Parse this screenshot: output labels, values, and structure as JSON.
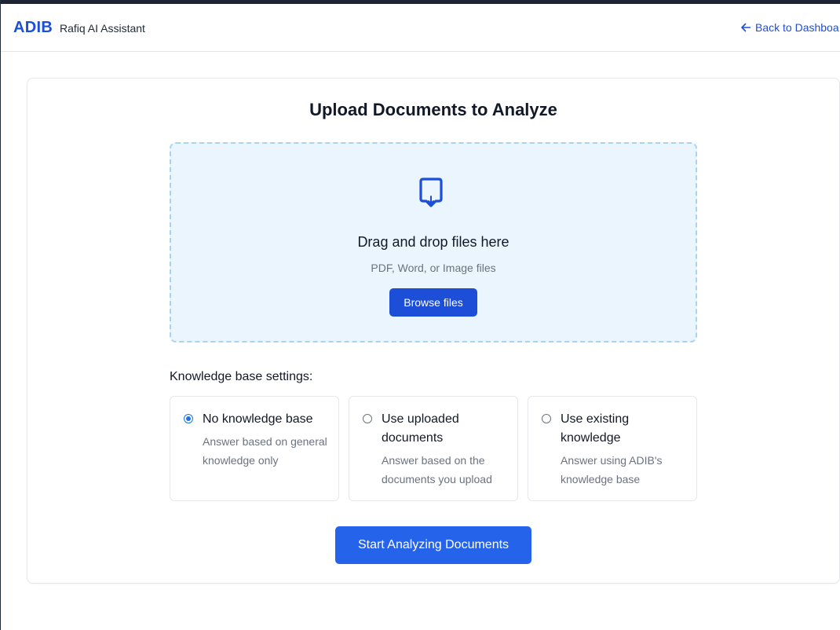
{
  "header": {
    "logo": "ADIB",
    "app_name": "Rafiq AI Assistant",
    "back_link": "Back to Dashboa"
  },
  "upload": {
    "title": "Upload Documents to Analyze",
    "drop_title": "Drag and drop files here",
    "drop_subtitle": "PDF, Word, or Image files",
    "browse_label": "Browse files",
    "icon": "upload-file-icon"
  },
  "knowledge": {
    "label": "Knowledge base settings:",
    "selected": "no-kb",
    "options": [
      {
        "id": "no-kb",
        "title": "No knowledge base",
        "description": "Answer based on general knowledge only",
        "checked": true
      },
      {
        "id": "uploaded",
        "title": "Use uploaded documents",
        "description": "Answer based on the documents you upload",
        "checked": false
      },
      {
        "id": "existing",
        "title": "Use existing knowledge",
        "description": "Answer using ADIB's knowledge base",
        "checked": false
      }
    ]
  },
  "actions": {
    "start_label": "Start Analyzing Documents"
  },
  "colors": {
    "brand": "#1d4ed8",
    "primary_button": "#2563eb",
    "dropzone_bg": "#ebf5fd",
    "dropzone_border": "#a9d3f1"
  }
}
